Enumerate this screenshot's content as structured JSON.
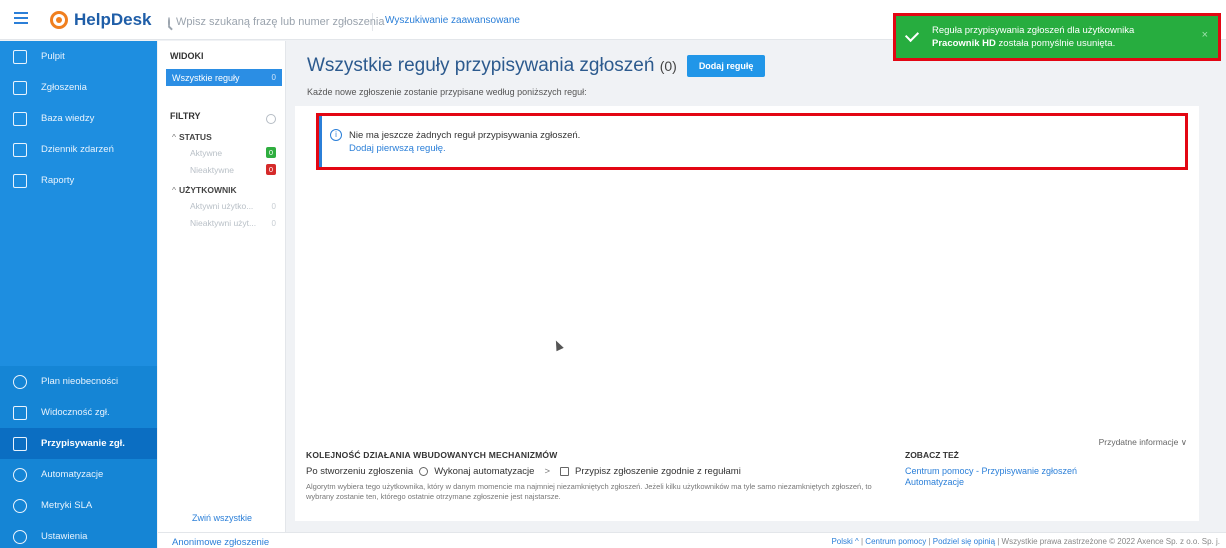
{
  "header": {
    "app_name": "HelpDesk",
    "search_placeholder": "Wpisz szukaną frazę lub numer zgłoszenia",
    "advanced_search": "Wyszukiwanie zaawansowane"
  },
  "toast": {
    "text_before": "Reguła przypisywania zgłoszeń dla użytkownika ",
    "user": "Pracownik HD",
    "text_after": " została pomyślnie usunięta.",
    "close": "×",
    "color": "#27ad3f"
  },
  "nav": {
    "items_top": [
      "Pulpit",
      "Zgłoszenia",
      "Baza wiedzy",
      "Dziennik zdarzeń",
      "Raporty"
    ],
    "items_bottom": [
      "Plan nieobecności",
      "Widoczność zgł.",
      "Przypisywanie zgł.",
      "Automatyzacje",
      "Metryki SLA",
      "Ustawienia"
    ],
    "active": "Przypisywanie zgł."
  },
  "views": {
    "heading": "WIDOKI",
    "all_rules": "Wszystkie reguły",
    "all_rules_count": "0",
    "filters_heading": "FILTRY",
    "status_heading": "STATUS",
    "status_items": [
      {
        "label": "Aktywne",
        "count": "0"
      },
      {
        "label": "Nieaktywne",
        "count": "0"
      }
    ],
    "user_heading": "UŻYTKOWNIK",
    "user_items": [
      {
        "label": "Aktywni użytko...",
        "count": "0"
      },
      {
        "label": "Nieaktywni użyt...",
        "count": "0"
      }
    ],
    "collapse_all": "Zwiń wszystkie"
  },
  "main": {
    "title": "Wszystkie reguły przypisywania zgłoszeń",
    "title_count": "(0)",
    "add_button": "Dodaj regułę",
    "subtitle": "Każde nowe zgłoszenie zostanie przypisane według poniższych reguł:",
    "empty_message": "Nie ma jeszcze żadnych reguł przypisywania zgłoszeń.",
    "empty_link": "Dodaj pierwszą regułę."
  },
  "info": {
    "useful": "Przydatne informacje",
    "mechanisms_heading": "KOLEJNOŚĆ DZIAŁANIA WBUDOWANYCH MECHANIZMÓW",
    "flow_step1": "Po stworzeniu zgłoszenia",
    "flow_step2": "Wykonaj automatyzacje",
    "flow_step3": "Przypisz zgłoszenie zgodnie z regułami",
    "algorithm": "Algorytm wybiera tego użytkownika, który w danym momencie ma najmniej niezamkniętych zgłoszeń. Jeżeli kilku użytkowników ma tyle samo niezamkniętych zgłoszeń, to wybrany zostanie ten, którego ostatnie otrzymane zgłoszenie jest najstarsze.",
    "see_also_heading": "ZOBACZ TEŻ",
    "see_also_1": "Centrum pomocy - Przypisywanie zgłoszeń",
    "see_also_2": "Automatyzacje"
  },
  "footer": {
    "anonymous": "Anonimowe zgłoszenie",
    "language": "Polski",
    "help_center": "Centrum pomocy",
    "feedback": "Podziel się opinią",
    "copyright": "Wszystkie prawa zastrzeżone © 2022 Axence Sp. z o.o. Sp. j."
  }
}
